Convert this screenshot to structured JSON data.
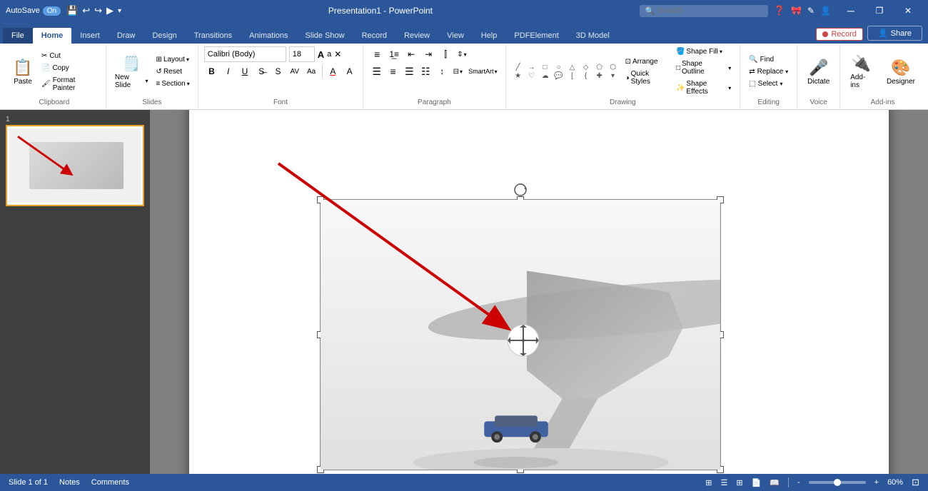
{
  "titlebar": {
    "autosave_label": "AutoSave",
    "autosave_state": "On",
    "title": "Presentation1 - PowerPoint",
    "search_placeholder": "Search",
    "help_icon": "?",
    "minimize_label": "─",
    "restore_label": "❐",
    "close_label": "✕",
    "ribbon_icon": "🎀",
    "pen_icon": "✎",
    "account_icon": "👤"
  },
  "ribbon": {
    "tabs": [
      "File",
      "Home",
      "Insert",
      "Draw",
      "Design",
      "Transitions",
      "Animations",
      "Slide Show",
      "Record",
      "Review",
      "View",
      "Help",
      "PDFElement",
      "3D Model"
    ],
    "active_tab": "3D Model",
    "groups": {
      "clipboard": {
        "label": "Clipboard",
        "paste_label": "Paste",
        "cut_label": "Cut",
        "copy_label": "Copy",
        "format_painter_label": "Format Painter"
      },
      "slides": {
        "label": "Slides",
        "new_slide_label": "New Slide",
        "layout_label": "Layout",
        "reset_label": "Reset",
        "section_label": "Section"
      },
      "font": {
        "label": "Font",
        "font_name": "Calibri (Body)",
        "font_size": "18",
        "bold": "B",
        "italic": "I",
        "underline": "U",
        "strikethrough": "S",
        "shadow": "S",
        "char_spacing": "AV",
        "font_color": "A",
        "grow_font": "A",
        "shrink_font": "a"
      },
      "paragraph": {
        "label": "Paragraph",
        "text_direction_label": "Text Direction",
        "align_text_label": "Align Text",
        "convert_smartart_label": "Convert to SmartArt"
      },
      "drawing": {
        "label": "Drawing",
        "shape_fill_label": "Shape Fill",
        "shape_outline_label": "Shape Outline",
        "shape_effects_label": "Shape Effects",
        "arrange_label": "Arrange",
        "quick_styles_label": "Quick Styles"
      },
      "editing": {
        "label": "Editing",
        "find_label": "Find",
        "replace_label": "Replace",
        "select_label": "Select"
      },
      "voice": {
        "label": "Voice",
        "dictate_label": "Dictate"
      },
      "addins": {
        "label": "Add-ins",
        "addins_btn_label": "Add-ins",
        "designer_label": "Designer"
      }
    }
  },
  "slide_panel": {
    "slide_number": "1"
  },
  "canvas": {
    "slide_bg": "#ffffff"
  },
  "model": {
    "rotation_icon": "⊕",
    "move_icon": "⊕"
  },
  "statusbar": {
    "slide_info": "Slide 1 of 1",
    "notes_label": "Notes",
    "comments_label": "Comments",
    "zoom_level": "60%",
    "view_normal": "▦",
    "view_outline": "☰",
    "view_slidesorter": "⊞",
    "view_notes": "📝",
    "view_reading": "📖"
  },
  "record_button": {
    "label": "Record"
  },
  "share_button": {
    "label": "Share"
  }
}
